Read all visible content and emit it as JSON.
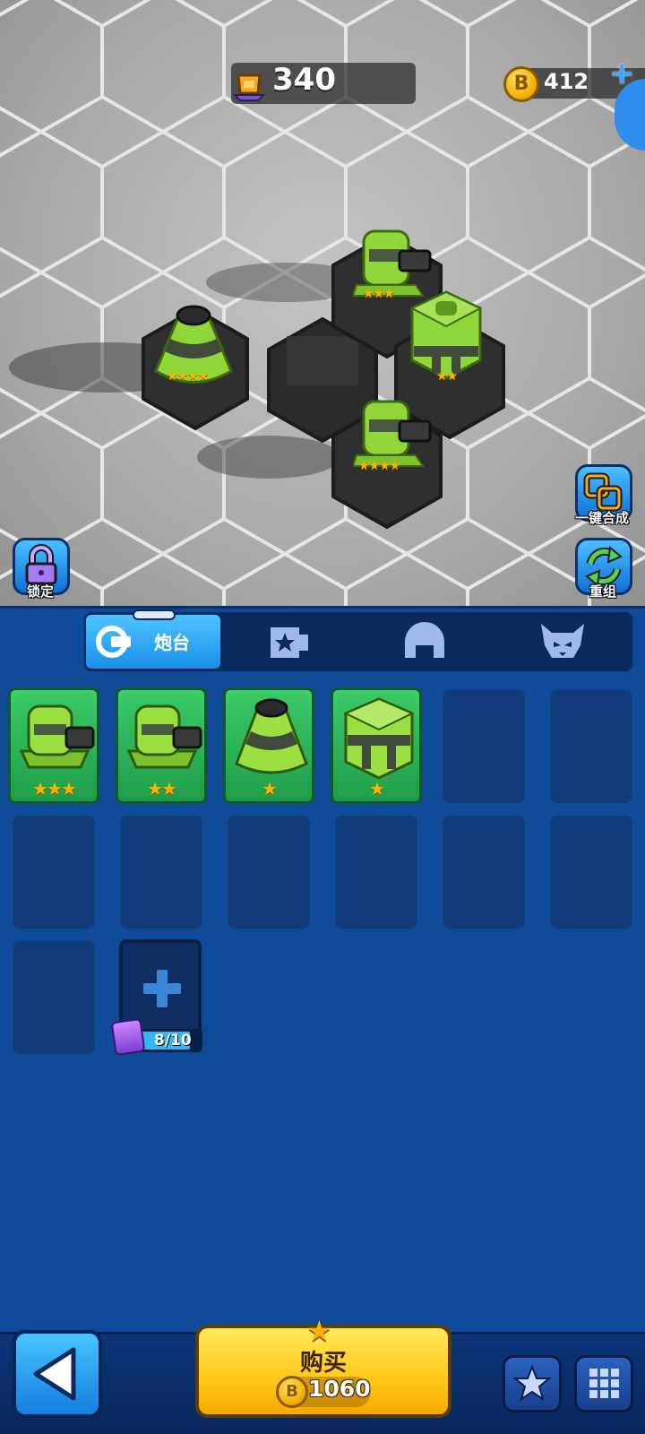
{
  "hud": {
    "trophies": "340",
    "coins": "412"
  },
  "field": {
    "turrets": [
      {
        "type": "cone",
        "stars": "★★★★"
      },
      {
        "type": "cannon",
        "stars": "★★★"
      },
      {
        "type": "barrel",
        "stars": "★★"
      },
      {
        "type": "cannon",
        "stars": "★★★★"
      }
    ],
    "merge_all_label": "一键合成",
    "reorganize_label": "重组",
    "lock_label": "锁定"
  },
  "tabs": [
    {
      "label": "炮台",
      "icon": "turret-tab-icon",
      "active": true
    },
    {
      "label": "",
      "icon": "star-gear-tab-icon",
      "active": false
    },
    {
      "label": "",
      "icon": "helmet-tab-icon",
      "active": false
    },
    {
      "label": "",
      "icon": "monster-tab-icon",
      "active": false
    }
  ],
  "inventory": {
    "cards": [
      {
        "type": "cannon",
        "stars": "★★★"
      },
      {
        "type": "cannon",
        "stars": "★★"
      },
      {
        "type": "cone",
        "stars": "★"
      },
      {
        "type": "barrel",
        "stars": "★"
      }
    ],
    "capacity": "8/10"
  },
  "bottom": {
    "buy_label": "购买",
    "price": "1060"
  },
  "colors": {
    "panel_bg": "#0f4a98",
    "accent_blue": "#36b6f5",
    "turret_green": "#8fd63a",
    "buy_yellow": "#ffc81a"
  }
}
